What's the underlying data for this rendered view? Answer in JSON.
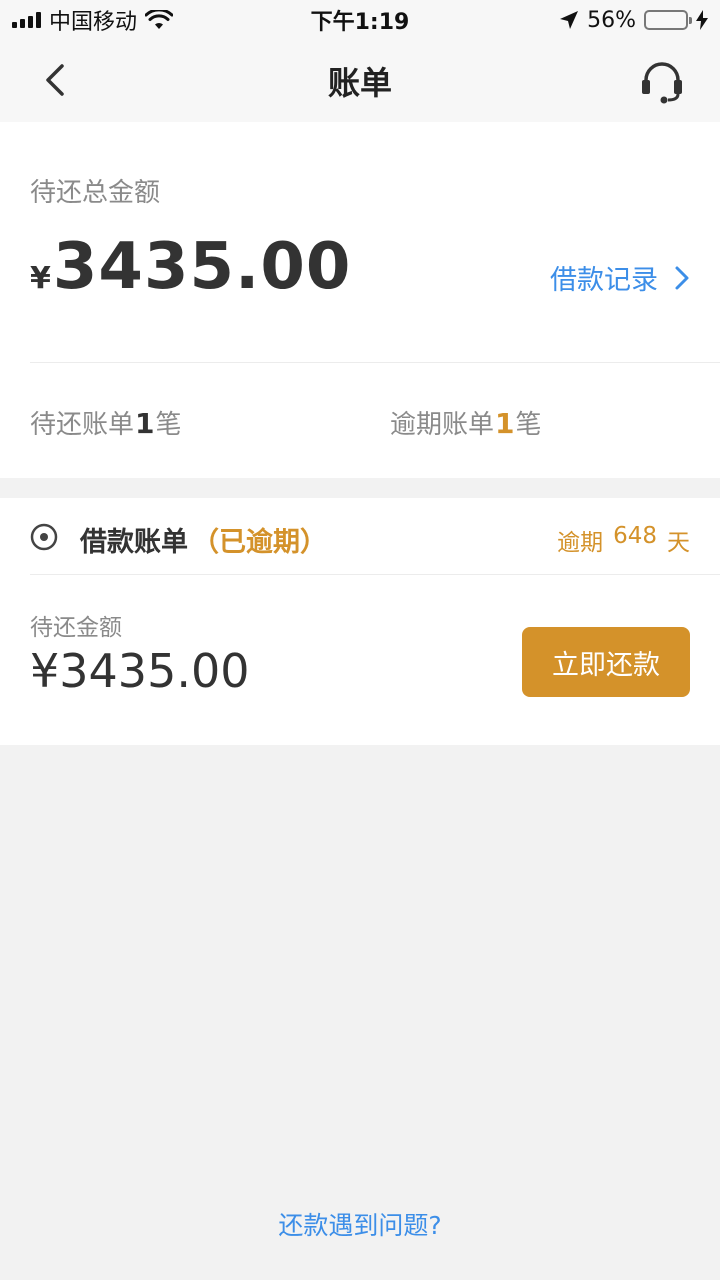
{
  "status_bar": {
    "carrier": "中国移动",
    "time": "下午1:19",
    "battery_percent": "56%",
    "battery_level": 0.56,
    "icons": [
      "signal-icon",
      "wifi-icon",
      "location-icon",
      "battery-icon",
      "charging-icon"
    ]
  },
  "nav": {
    "title": "账单",
    "icons": [
      "back-chevron-icon",
      "customer-service-headset-icon"
    ]
  },
  "summary": {
    "label": "待还总金额",
    "currency": "¥",
    "amount": "3435.00",
    "loan_record_label": "借款记录",
    "pending": {
      "prefix": "待还账单",
      "count": "1",
      "suffix": "笔"
    },
    "overdue": {
      "prefix": "逾期账单",
      "count": "1",
      "suffix": "笔"
    }
  },
  "bill": {
    "title": "借款账单",
    "status": "（已逾期）",
    "overdue_label": "逾期",
    "overdue_days": "648",
    "overdue_unit": "天",
    "amount_label": "待还金额",
    "amount": "¥3435.00",
    "pay_button_label": "立即还款"
  },
  "footer": {
    "help_label": "还款遇到问题?"
  },
  "colors": {
    "accent_orange": "#d4922a",
    "link_blue": "#3c8ee8",
    "background": "#f2f2f2"
  }
}
